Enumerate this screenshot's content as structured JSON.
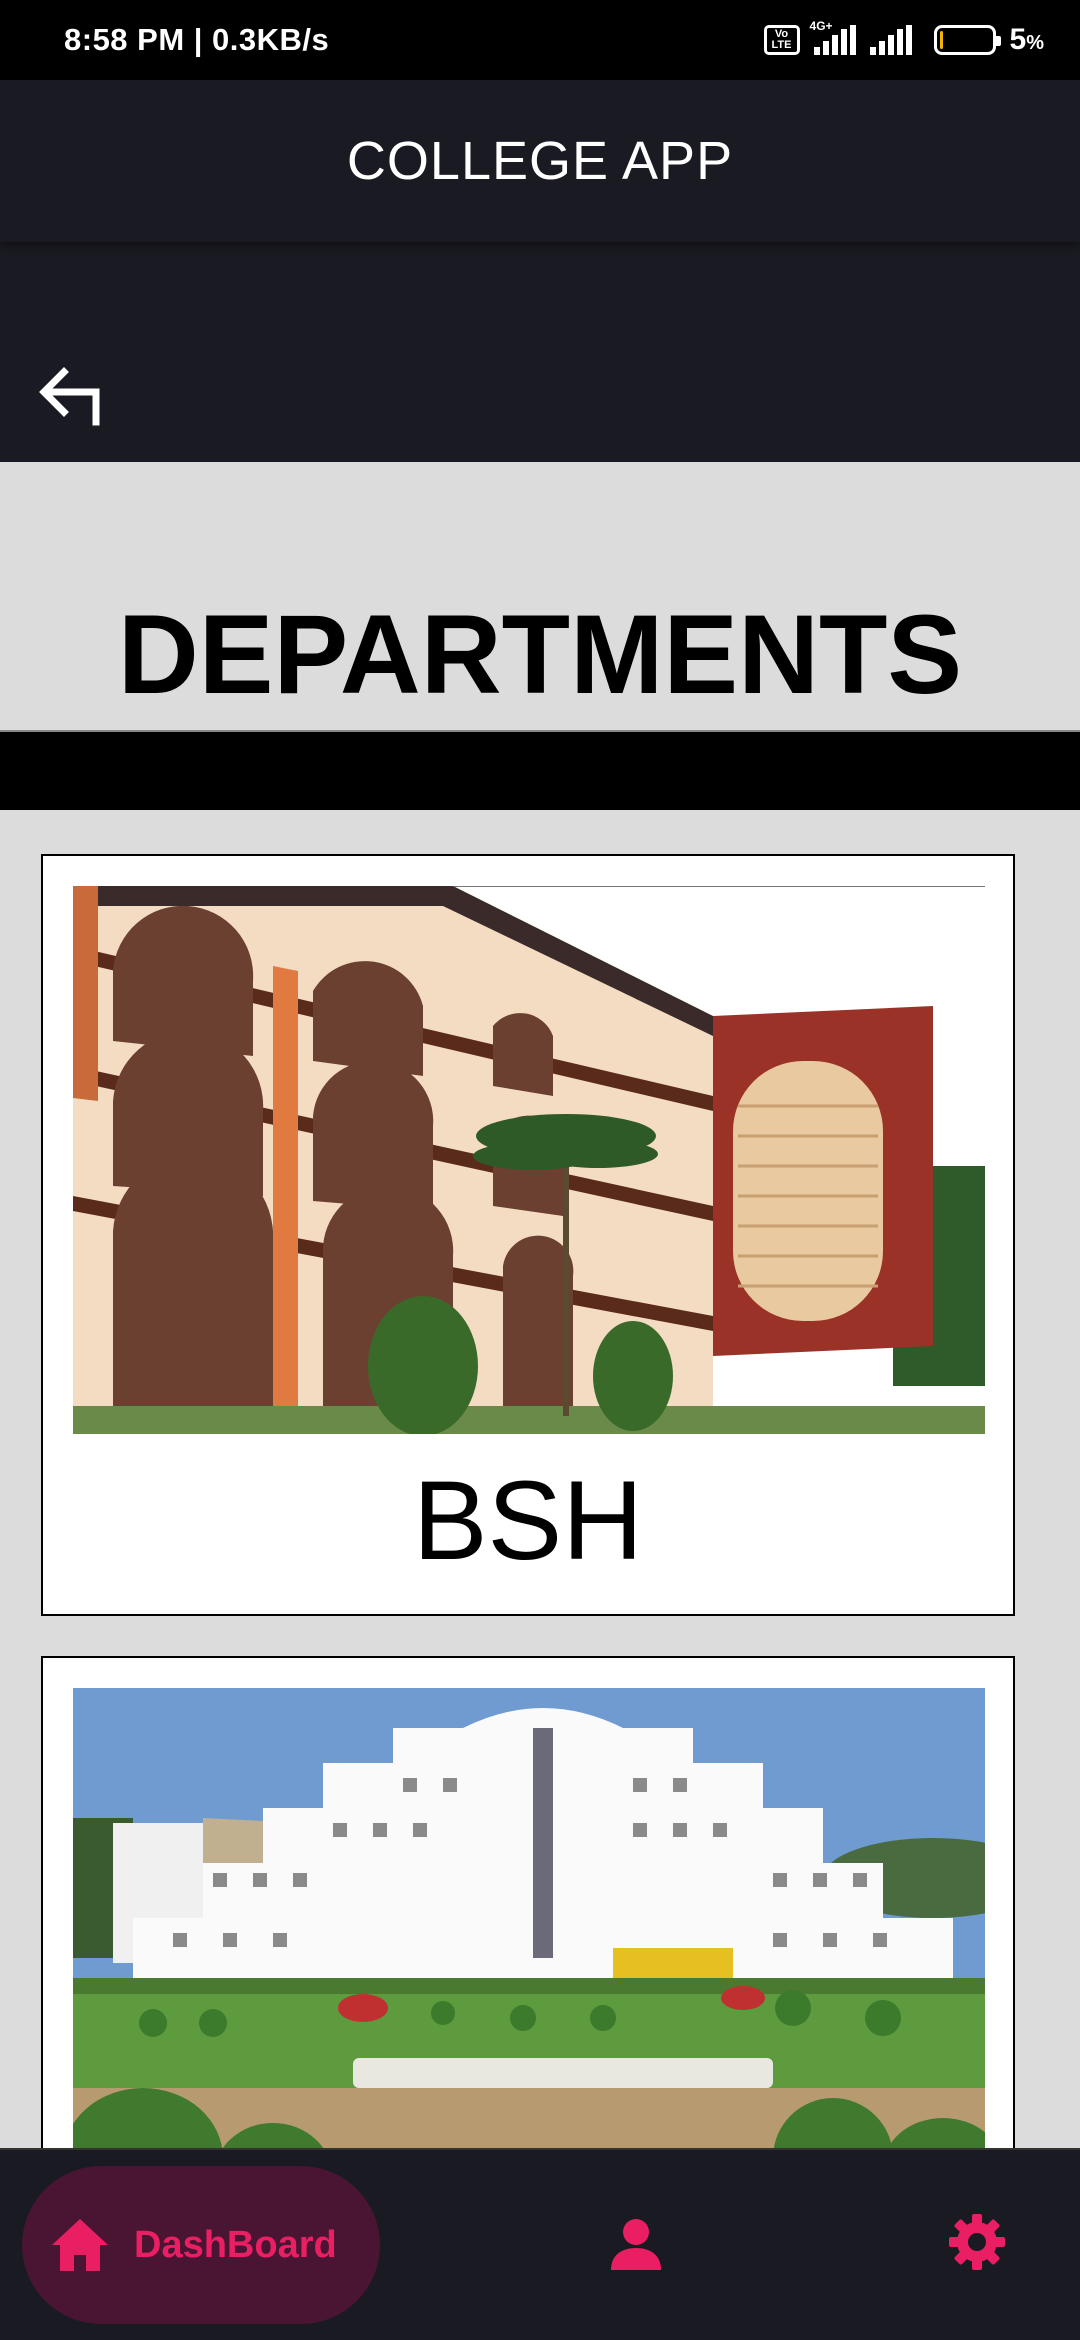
{
  "status_bar": {
    "time_speed": "8:58 PM | 0.3KB/s",
    "network_type": "4G+",
    "volte_top": "Vo",
    "volte_bottom": "LTE",
    "battery_percent": "5",
    "battery_unit": "%",
    "battery_level": 0.05
  },
  "app_bar": {
    "title": "COLLEGE APP"
  },
  "icons": {
    "back": "back-arrow-icon",
    "home": "home-icon",
    "profile": "person-icon",
    "settings": "gear-icon"
  },
  "page": {
    "heading": "DEPARTMENTS"
  },
  "departments": [
    {
      "label": "BSH"
    }
  ],
  "bottom_nav": {
    "active_label": "DashBoard"
  },
  "colors": {
    "accent": "#e91e63",
    "accent_pill": "#4a1532",
    "bar_dark": "#1a1a22",
    "page_bg": "#dcdcdc"
  }
}
